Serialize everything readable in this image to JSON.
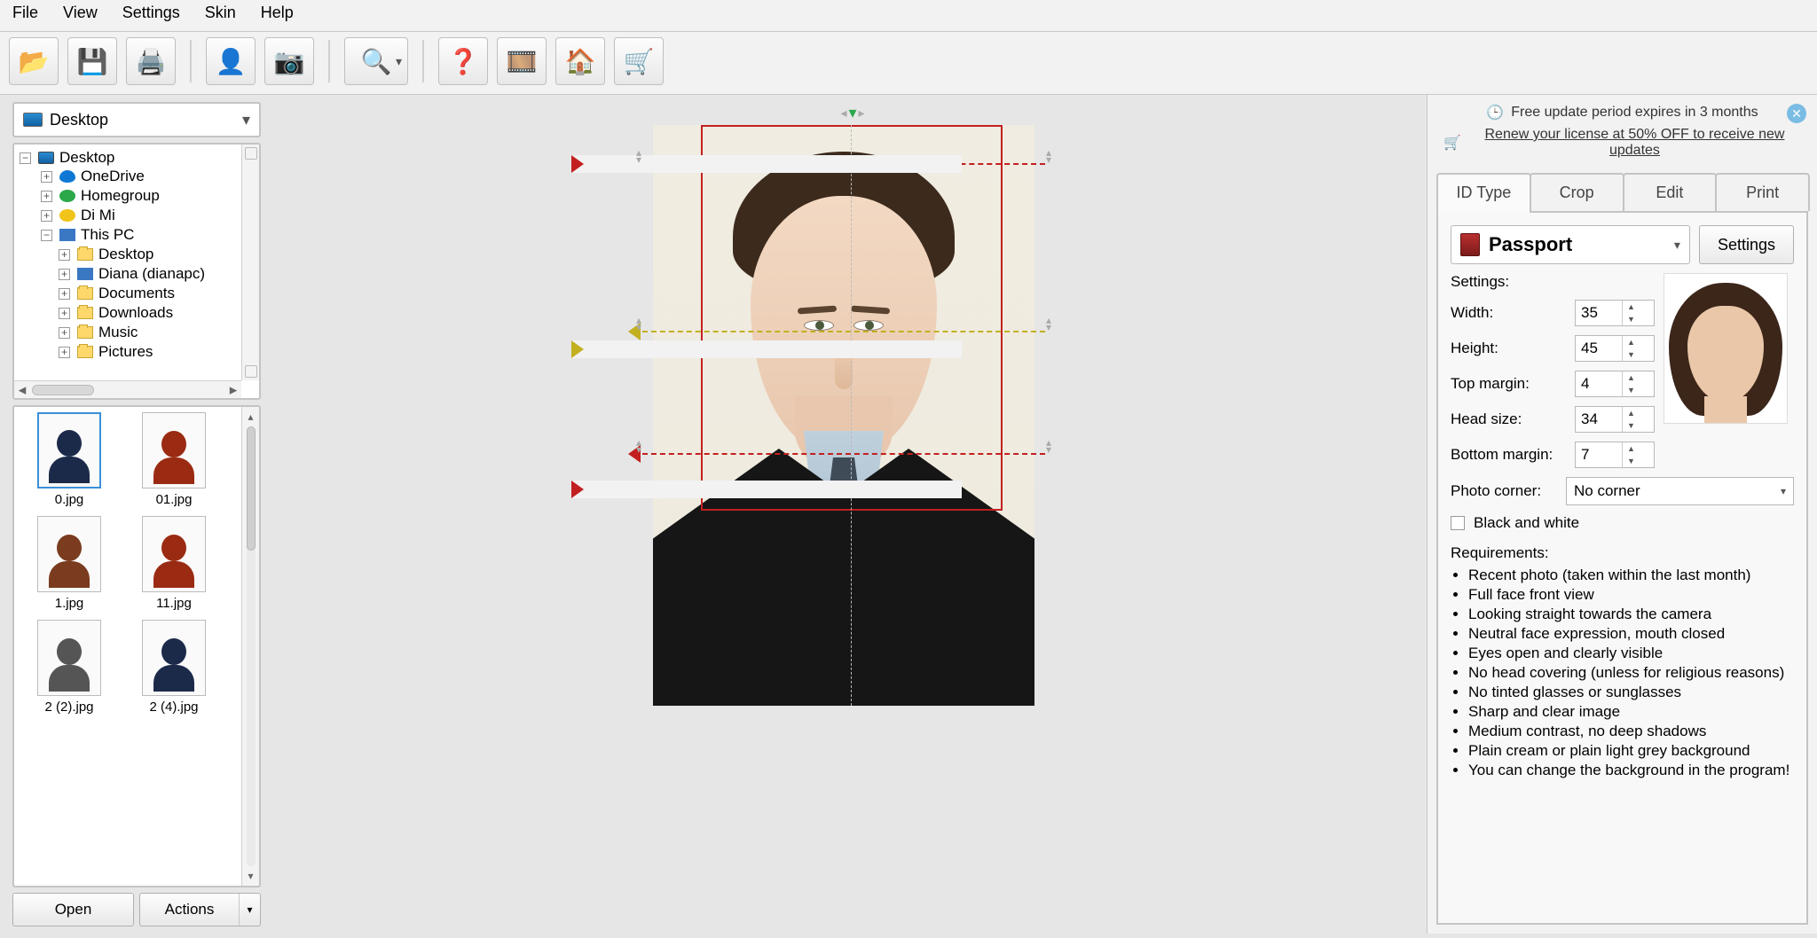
{
  "menu": {
    "items": [
      "File",
      "View",
      "Settings",
      "Skin",
      "Help"
    ]
  },
  "notice": {
    "expiry": "Free update period expires in 3 months",
    "renew": "Renew your license at 50% OFF to receive new updates"
  },
  "sidebar": {
    "location": "Desktop",
    "tree": {
      "root": "Desktop",
      "items": [
        {
          "label": "OneDrive",
          "icon": "cloud",
          "depth": 1,
          "tw": "+"
        },
        {
          "label": "Homegroup",
          "icon": "group",
          "depth": 1,
          "tw": "+"
        },
        {
          "label": "Di Mi",
          "icon": "user",
          "depth": 1,
          "tw": "+"
        },
        {
          "label": "This PC",
          "icon": "pc",
          "depth": 1,
          "tw": "−"
        },
        {
          "label": "Desktop",
          "icon": "folder",
          "depth": 2,
          "tw": "+"
        },
        {
          "label": "Diana (dianapc)",
          "icon": "pc",
          "depth": 2,
          "tw": "+"
        },
        {
          "label": "Documents",
          "icon": "folder",
          "depth": 2,
          "tw": "+"
        },
        {
          "label": "Downloads",
          "icon": "folder",
          "depth": 2,
          "tw": "+"
        },
        {
          "label": "Music",
          "icon": "folder",
          "depth": 2,
          "tw": "+"
        },
        {
          "label": "Pictures",
          "icon": "folder",
          "depth": 2,
          "tw": "+"
        }
      ]
    },
    "thumbs": [
      {
        "name": "0.jpg",
        "selected": true,
        "sil": "navy"
      },
      {
        "name": "01.jpg",
        "selected": false,
        "sil": "red"
      },
      {
        "name": "1.jpg",
        "selected": false,
        "sil": "brown"
      },
      {
        "name": "11.jpg",
        "selected": false,
        "sil": "red"
      },
      {
        "name": "2 (2).jpg",
        "selected": false,
        "sil": "grey"
      },
      {
        "name": "2 (4).jpg",
        "selected": false,
        "sil": "navy"
      }
    ],
    "open_label": "Open",
    "actions_label": "Actions"
  },
  "tabs": {
    "items": [
      "ID Type",
      "Crop",
      "Edit",
      "Print"
    ],
    "active": 0,
    "id_type": {
      "selected": "Passport",
      "settings_button": "Settings",
      "settings_heading": "Settings:",
      "fields": {
        "width": {
          "label": "Width:",
          "value": "35"
        },
        "height": {
          "label": "Height:",
          "value": "45"
        },
        "top_margin": {
          "label": "Top margin:",
          "value": "4"
        },
        "head_size": {
          "label": "Head size:",
          "value": "34"
        },
        "bottom_margin": {
          "label": "Bottom margin:",
          "value": "7"
        }
      },
      "corner": {
        "label": "Photo corner:",
        "value": "No corner"
      },
      "bw": {
        "label": "Black and white",
        "checked": false
      },
      "requirements_heading": "Requirements:",
      "requirements": [
        "Recent photo (taken within the last month)",
        "Full face front view",
        "Looking straight towards the camera",
        "Neutral face expression, mouth closed",
        "Eyes open and clearly visible",
        "No head covering (unless for religious reasons)",
        "No tinted glasses or sunglasses",
        "Sharp and clear image",
        "Medium contrast, no deep shadows",
        "Plain cream or plain light grey background",
        "You can change the background in the program!"
      ]
    }
  }
}
